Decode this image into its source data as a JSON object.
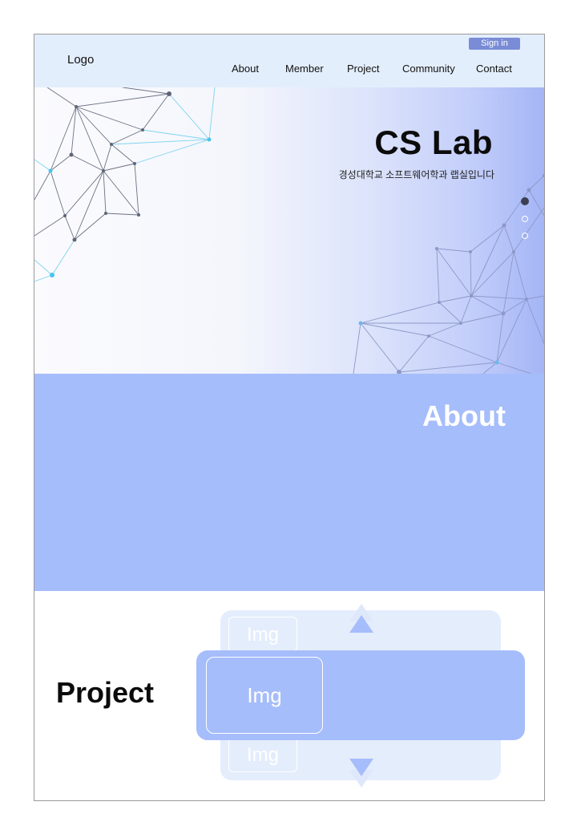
{
  "header": {
    "logo": "Logo",
    "sign_in": "Sign in",
    "nav": [
      "About",
      "Member",
      "Project",
      "Community",
      "Contact"
    ]
  },
  "hero": {
    "title": "CS Lab",
    "subtitle": "경성대학교 소프트웨어학과 랩실입니다",
    "slides": 3,
    "active_slide": 1
  },
  "about": {
    "title": "About"
  },
  "project": {
    "title": "Project",
    "carousel": {
      "prev_label": "Img",
      "current_label": "Img",
      "next_label": "Img"
    }
  },
  "colors": {
    "header_bg": "#e3eefc",
    "accent": "#a6bdfb",
    "signin_bg": "#7a8cd6",
    "card_back": "#e4edfc",
    "network_dark": "#5f6577",
    "network_cyan": "#46c5ee"
  },
  "icons": [
    "up-arrow-icon",
    "down-arrow-icon"
  ]
}
